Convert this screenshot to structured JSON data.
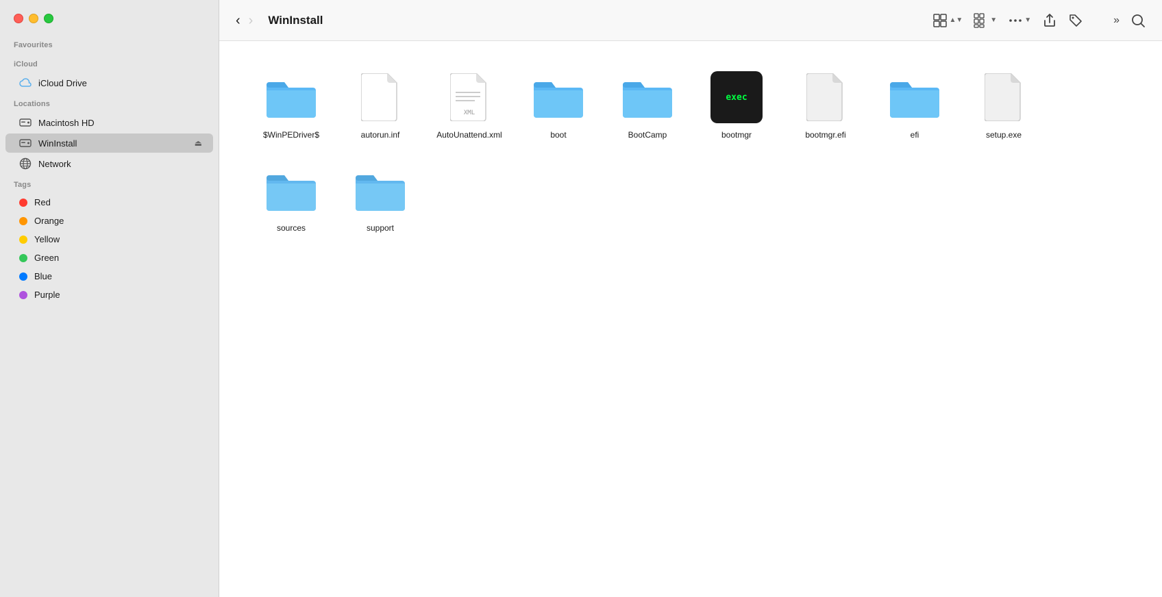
{
  "sidebar": {
    "sections": {
      "favourites": {
        "label": "Favourites",
        "items": []
      },
      "icloud": {
        "label": "iCloud",
        "items": [
          {
            "id": "icloud-drive",
            "label": "iCloud Drive",
            "icon": "icloud-icon"
          }
        ]
      },
      "locations": {
        "label": "Locations",
        "items": [
          {
            "id": "macintosh-hd",
            "label": "Macintosh HD",
            "icon": "disk-icon",
            "active": false
          },
          {
            "id": "wininstall",
            "label": "WinInstall",
            "icon": "disk-icon",
            "active": true,
            "eject": true
          },
          {
            "id": "network",
            "label": "Network",
            "icon": "globe-icon",
            "active": false
          }
        ]
      },
      "tags": {
        "label": "Tags",
        "items": [
          {
            "id": "red",
            "label": "Red",
            "color": "#ff3b30"
          },
          {
            "id": "orange",
            "label": "Orange",
            "color": "#ff9500"
          },
          {
            "id": "yellow",
            "label": "Yellow",
            "color": "#ffcc00"
          },
          {
            "id": "green",
            "label": "Green",
            "color": "#34c759"
          },
          {
            "id": "blue",
            "label": "Blue",
            "color": "#007aff"
          },
          {
            "id": "purple",
            "label": "Purple",
            "color": "#af52de"
          }
        ]
      }
    }
  },
  "toolbar": {
    "title": "WinInstall",
    "back_disabled": false,
    "forward_disabled": true
  },
  "files": [
    {
      "id": "winpedriver",
      "name": "$WinPEDriver$",
      "type": "folder"
    },
    {
      "id": "autorun",
      "name": "autorun.inf",
      "type": "doc"
    },
    {
      "id": "autounattend",
      "name": "AutoUnattend.xml",
      "type": "xml"
    },
    {
      "id": "boot",
      "name": "boot",
      "type": "folder"
    },
    {
      "id": "bootcamp",
      "name": "BootCamp",
      "type": "folder"
    },
    {
      "id": "bootmgr",
      "name": "bootmgr",
      "type": "exec"
    },
    {
      "id": "bootmgrefi",
      "name": "bootmgr.efi",
      "type": "doc-gray"
    },
    {
      "id": "efi",
      "name": "efi",
      "type": "folder"
    },
    {
      "id": "setupexe",
      "name": "setup.exe",
      "type": "doc-gray"
    },
    {
      "id": "sources",
      "name": "sources",
      "type": "folder-light"
    },
    {
      "id": "support",
      "name": "support",
      "type": "folder-light"
    }
  ]
}
